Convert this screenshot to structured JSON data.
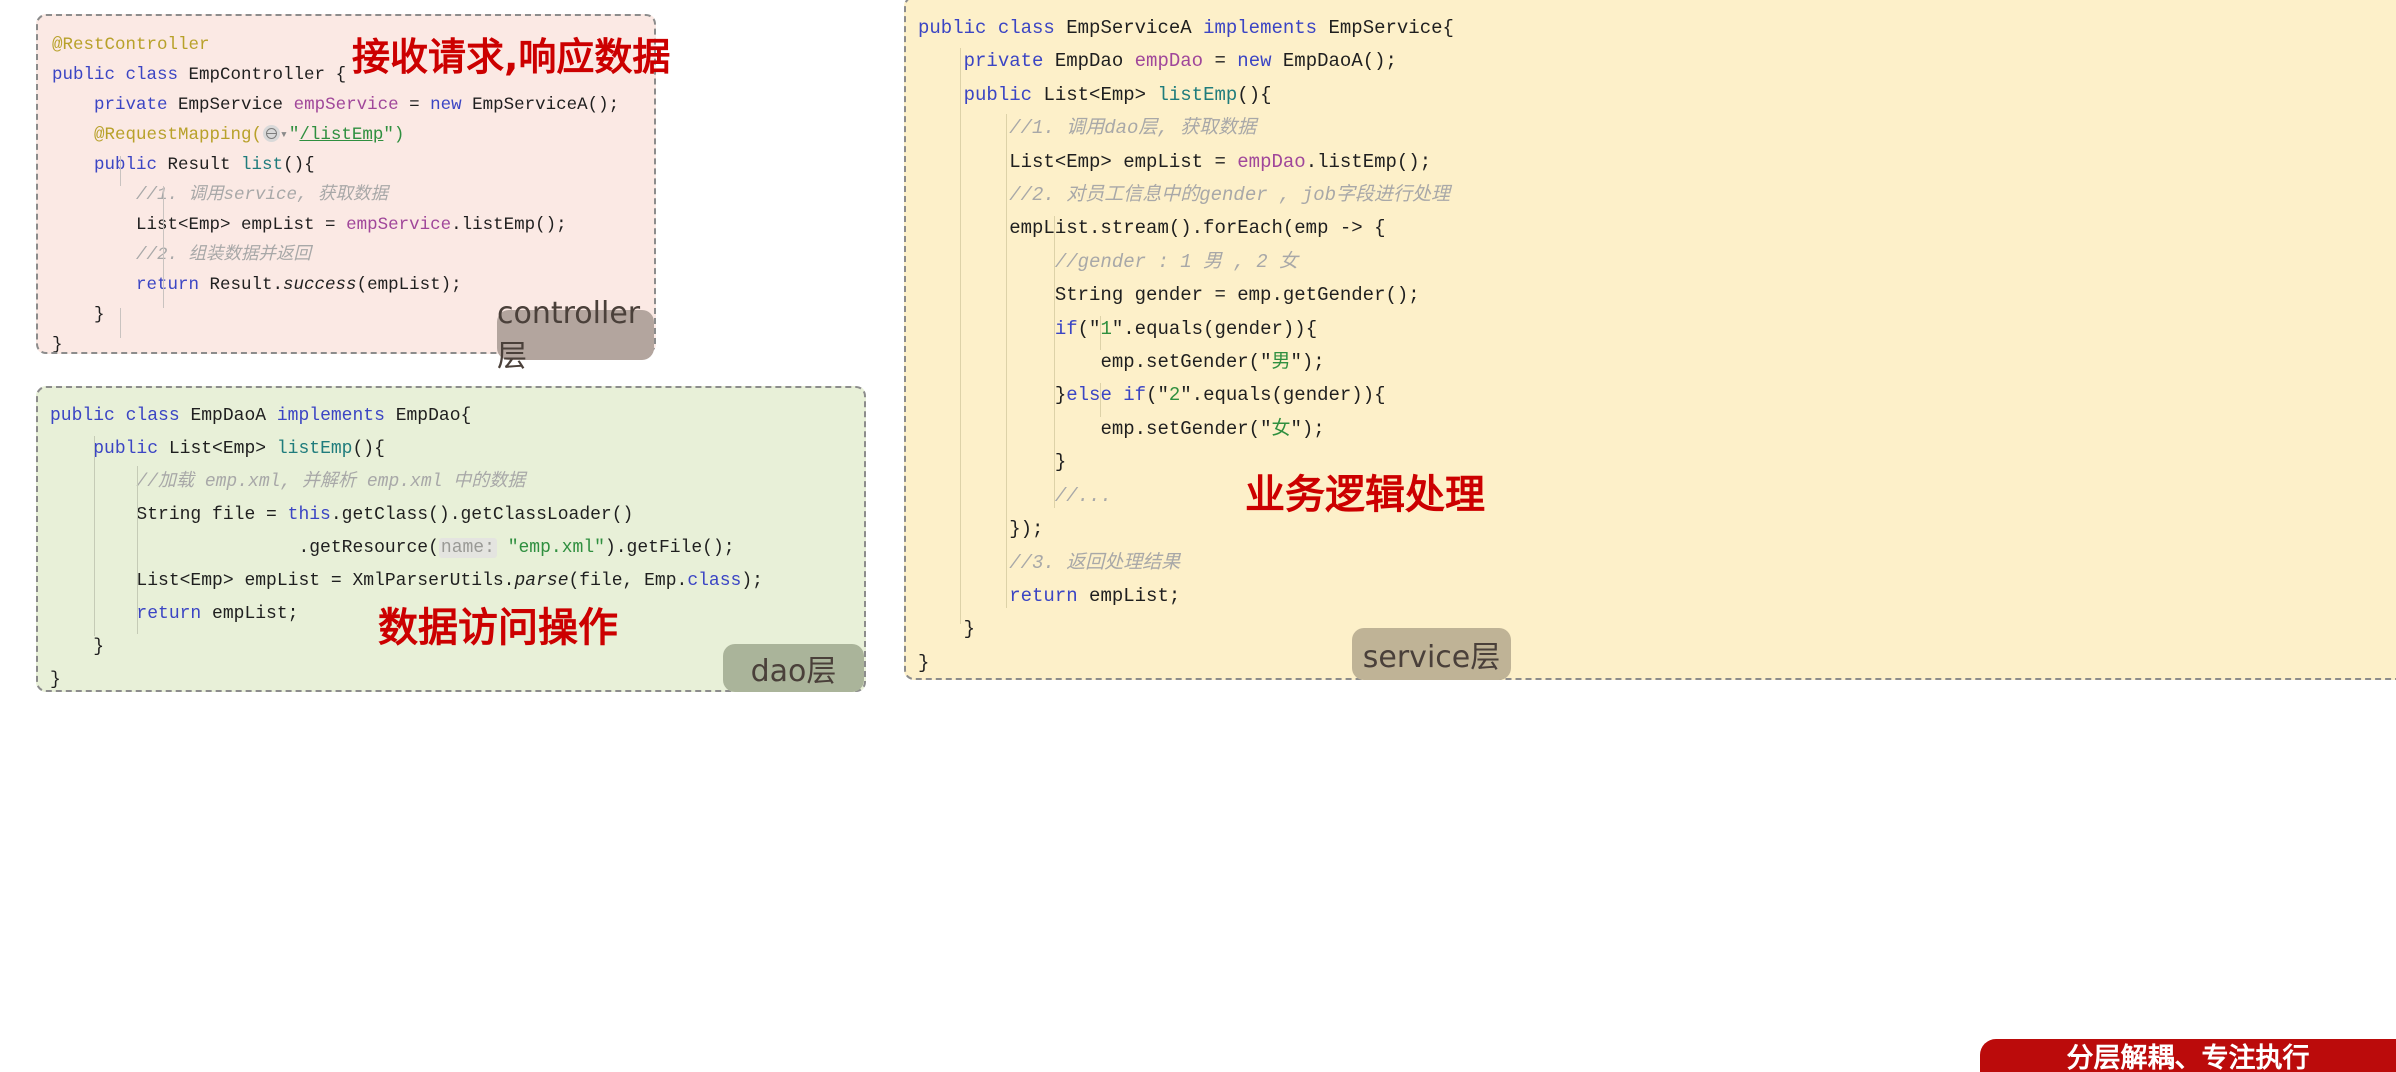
{
  "controller": {
    "background": "#fbe9e4",
    "badge": "controller层",
    "note": "接收请求,响应数据",
    "lines": {
      "l1": "@RestController",
      "l2_a": "public class ",
      "l2_b": "EmpController",
      "l2_c": " {",
      "l3_a": "private ",
      "l3_b": "EmpService",
      "l3_c": " empService ",
      "l3_d": "= ",
      "l3_e": "new ",
      "l3_f": "EmpServiceA();",
      "l4_a": "@RequestMapping(",
      "l4_icon": "globe-icon",
      "l4_chevron": "chevron-down-icon",
      "l4_b": "\"",
      "l4_link": "/listEmp",
      "l4_c": "\")",
      "l5_a": "public ",
      "l5_b": "Result ",
      "l5_c": "list",
      "l5_d": "(){",
      "l6": "//1. 调用service, 获取数据",
      "l7_a": "List<Emp> empList = ",
      "l7_b": "empService",
      "l7_c": ".listEmp();",
      "l8": "//2. 组装数据并返回",
      "l9_a": "return ",
      "l9_b": "Result.",
      "l9_c": "success",
      "l9_d": "(empList);",
      "l10": "}",
      "l11": "}"
    }
  },
  "dao": {
    "background": "#e8f0d8",
    "badge": "dao层",
    "note": "数据访问操作",
    "lines": {
      "l1_a": "public class ",
      "l1_b": "EmpDaoA ",
      "l1_c": "implements ",
      "l1_d": "EmpDao{",
      "l2_a": "public ",
      "l2_b": "List<Emp> ",
      "l2_c": "listEmp",
      "l2_d": "(){",
      "l3": "//加载 emp.xml, 并解析 emp.xml 中的数据",
      "l4_a": "String file = ",
      "l4_b": "this",
      "l4_c": ".getClass().getClassLoader()",
      "l5_a": ".getResource(",
      "l5_hint": "name:",
      "l5_b": " \"emp.xml\"",
      "l5_c": ").getFile();",
      "l6_a": "List<Emp> empList = XmlParserUtils.",
      "l6_b": "parse",
      "l6_c": "(file, Emp.",
      "l6_d": "class",
      "l6_e": ");",
      "l7_a": "return ",
      "l7_b": "empList;",
      "l8": "}",
      "l9": "}"
    }
  },
  "service": {
    "background": "#fdf0c9",
    "badge": "service层",
    "note": "业务逻辑处理",
    "lines": {
      "l1_a": "public class ",
      "l1_b": "EmpServiceA ",
      "l1_c": "implements ",
      "l1_d": "EmpService{",
      "l2_a": "private ",
      "l2_b": "EmpDao ",
      "l2_c": "empDao ",
      "l2_d": "= ",
      "l2_e": "new ",
      "l2_f": "EmpDaoA();",
      "l3_a": "public ",
      "l3_b": "List<Emp> ",
      "l3_c": "listEmp",
      "l3_d": "(){",
      "l4": "//1. 调用dao层, 获取数据",
      "l5_a": "List<Emp> empList = ",
      "l5_b": "empDao",
      "l5_c": ".listEmp();",
      "l6": "//2. 对员工信息中的gender , job字段进行处理",
      "l7": "empList.stream().forEach(emp -> {",
      "l8": "//gender : 1 男 , 2 女",
      "l9": "String gender = emp.getGender();",
      "l10_a": "if",
      "l10_b": "(\"",
      "l10_c": "1",
      "l10_d": "\".equals(gender)){",
      "l11_a": "emp.setGender(\"",
      "l11_b": "男",
      "l11_c": "\");",
      "l12_a": "}",
      "l12_b": "else if",
      "l12_c": "(\"",
      "l12_d": "2",
      "l12_e": "\".equals(gender)){",
      "l13_a": "emp.setGender(\"",
      "l13_b": "女",
      "l13_c": "\");",
      "l14": "}",
      "l15": "//...",
      "l16": "});",
      "l17": "//3. 返回处理结果",
      "l18_a": "return ",
      "l18_b": "empList;",
      "l19": "}",
      "l20": "}"
    }
  },
  "banner": {
    "text": "分层解耦、专注执行",
    "color": "#bb0b0b"
  },
  "colors": {
    "keyword": "#3b45c4",
    "annotation": "#b8a12a",
    "field": "#a0479a",
    "method": "#1f7c7c",
    "comment": "#a8a8a8",
    "string": "#2f8f3f",
    "note_red": "#cc0000",
    "badge_controller": "#b3a59e",
    "badge_dao": "#aab49a",
    "badge_service": "#bfb396"
  }
}
